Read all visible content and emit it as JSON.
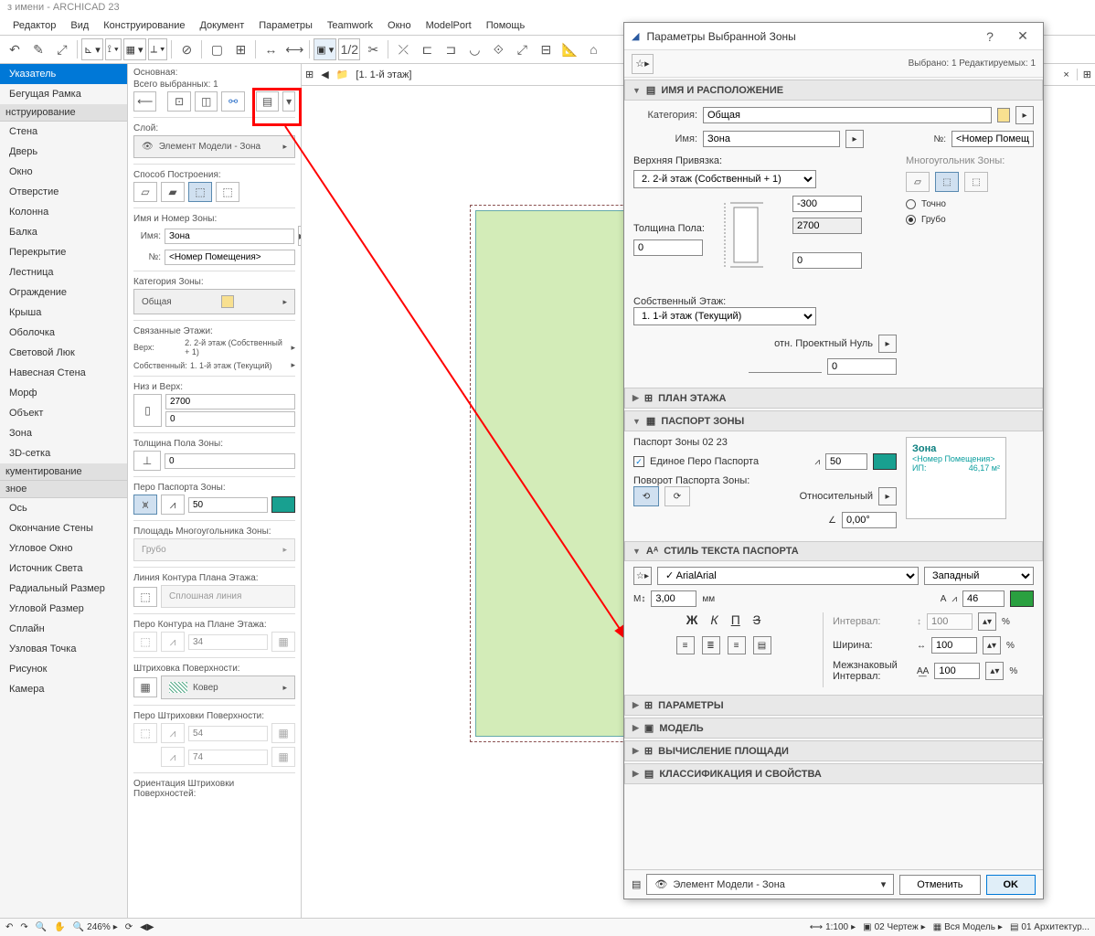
{
  "app": {
    "title": "з имени - ARCHICAD 23"
  },
  "menu": [
    "Редактор",
    "Вид",
    "Конструирование",
    "Документ",
    "Параметры",
    "Teamwork",
    "Окно",
    "ModelPort",
    "Помощь"
  ],
  "toolbox": {
    "sec_design": "Указатель",
    "marquee": "Бегущая Рамка",
    "sec_construct": "нструирование",
    "items_construct": [
      "Стена",
      "Дверь",
      "Окно",
      "Отверстие",
      "Колонна",
      "Балка",
      "Перекрытие",
      "Лестница",
      "Ограждение",
      "Крыша",
      "Оболочка",
      "Световой Люк",
      "Навесная Стена",
      "Морф",
      "Объект",
      "Зона",
      "3D-сетка"
    ],
    "sec_doc": "кументирование",
    "sec_misc": "зное",
    "items_misc": [
      "Ось",
      "Окончание Стены",
      "Угловое Окно",
      "Источник Света",
      "Радиальный Размер",
      "Угловой Размер",
      "Сплайн",
      "Узловая Точка",
      "Рисунок",
      "Камера"
    ]
  },
  "infopanel": {
    "header": "Основная:",
    "selected": "Всего выбранных: 1",
    "layer_lbl": "Слой:",
    "layer_val": "Элемент Модели - Зона",
    "method_lbl": "Способ Построения:",
    "namenum_lbl": "Имя и Номер Зоны:",
    "name_lbl": "Имя:",
    "name_val": "Зона",
    "num_lbl": "№:",
    "num_val": "<Номер Помещения>",
    "cat_lbl": "Категория Зоны:",
    "cat_val": "Общая",
    "linked_lbl": "Связанные Этажи:",
    "linked_top_lbl": "Верх:",
    "linked_top": "2. 2-й этаж (Собственный + 1)",
    "linked_own_lbl": "Собственный:",
    "linked_own": "1. 1-й этаж (Текущий)",
    "heights_lbl": "Низ и Верх:",
    "h_top": "2700",
    "h_bot": "0",
    "floor_thick_lbl": "Толщина Пола Зоны:",
    "floor_thick": "0",
    "pen_lbl": "Перо Паспорта Зоны:",
    "pen_val": "50",
    "area_lbl": "Площадь Многоугольника Зоны:",
    "area_val": "Грубо",
    "contour_lbl": "Линия Контура Плана Этажа:",
    "contour_val": "Сплошная линия",
    "contour_pen_lbl": "Перо Контура на Плане Этажа:",
    "cp1": "34",
    "hatch_lbl": "Штриховка Поверхности:",
    "hatch_val": "Ковер",
    "hatch_pen_lbl": "Перо Штриховки Поверхности:",
    "hp1": "54",
    "hp2": "74",
    "hatch_orient_lbl": "Ориентация Штриховки Поверхностей:"
  },
  "worktab": {
    "label": "[1. 1-й этаж]"
  },
  "dialog": {
    "title": "Параметры Выбранной Зоны",
    "status": "Выбрано: 1 Редактируемых: 1",
    "sec_name": "ИМЯ И РАСПОЛОЖЕНИЕ",
    "cat_lbl": "Категория:",
    "cat_val": "Общая",
    "name_lbl": "Имя:",
    "name_val": "Зона",
    "num_lbl": "№:",
    "num_val": "<Номер Помещ",
    "top_link_lbl": "Верхняя Привязка:",
    "top_link_val": "2. 2-й этаж (Собственный + 1)",
    "poly_lbl": "Многоугольник Зоны:",
    "poly_opt1": "Точно",
    "poly_opt2": "Грубо",
    "v_neg300": "-300",
    "v_2700": "2700",
    "v_0a": "0",
    "v_0b": "0",
    "floor_thick_lbl": "Толщина Пола:",
    "floor_thick_val": "0",
    "own_story_lbl": "Собственный Этаж:",
    "own_story_val": "1. 1-й этаж (Текущий)",
    "proj_zero_lbl": "отн. Проектный Нуль",
    "proj_zero_val": "0",
    "sec_plan": "ПЛАН ЭТАЖА",
    "sec_stamp": "ПАСПОРТ ЗОНЫ",
    "stamp_name": "Паспорт Зоны 02 23",
    "stamp_chk": "Единое Перо Паспорта",
    "stamp_pen": "50",
    "stamp_rot_lbl": "Поворот Паспорта Зоны:",
    "stamp_rel": "Относительный",
    "stamp_ang": "0,00°",
    "preview_zone": "Зона",
    "preview_room": "<Номер Помещения>",
    "preview_ip": "ИП:",
    "preview_area": "46,17 м²",
    "sec_textstyle": "СТИЛЬ ТЕКСТА ПАСПОРТА",
    "font": "Arial",
    "script": "Западный",
    "size": "3,00",
    "size_unit": "мм",
    "pen2": "46",
    "bold": "Ж",
    "italic": "К",
    "under": "П",
    "strike": "З",
    "spacing_lbl": "Интервал:",
    "spacing": "100",
    "width_lbl": "Ширина:",
    "width": "100",
    "kern_lbl": "Межзнаковый Интервал:",
    "kern": "100",
    "pct": "%",
    "sec_params": "ПАРАМЕТРЫ",
    "sec_model": "МОДЕЛЬ",
    "sec_calc": "ВЫЧИСЛЕНИЕ ПЛОЩАДИ",
    "sec_class": "КЛАССИФИКАЦИЯ И СВОЙСТВА",
    "layer": "Элемент Модели - Зона",
    "btn_cancel": "Отменить",
    "btn_ok": "OK"
  },
  "statusbar": {
    "zoom": "246%",
    "scale": "1:100",
    "view": "02 Чертеж",
    "model": "Вся Модель",
    "layer": "01 Архитектур..."
  }
}
